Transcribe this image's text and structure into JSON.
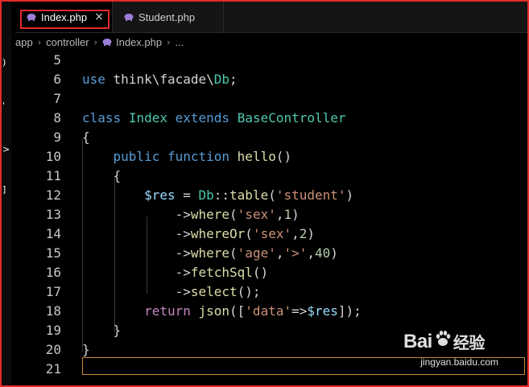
{
  "tabs": [
    {
      "label": "Index.php",
      "active": true,
      "close": "×"
    },
    {
      "label": "Student.php",
      "active": false
    }
  ],
  "breadcrumb": {
    "items": [
      "app",
      "controller",
      "Index.php",
      "..."
    ],
    "separator": "›"
  },
  "code_lines": [
    {
      "n": "5",
      "tokens": []
    },
    {
      "n": "6",
      "tokens": [
        [
          "kw",
          "use"
        ],
        [
          "plain",
          " think\\facade\\"
        ],
        [
          "cls",
          "Db"
        ],
        [
          "plain",
          ";"
        ]
      ]
    },
    {
      "n": "7",
      "tokens": []
    },
    {
      "n": "8",
      "tokens": [
        [
          "kw",
          "class"
        ],
        [
          "plain",
          " "
        ],
        [
          "cls",
          "Index"
        ],
        [
          "plain",
          " "
        ],
        [
          "kw",
          "extends"
        ],
        [
          "plain",
          " "
        ],
        [
          "cls",
          "BaseController"
        ]
      ]
    },
    {
      "n": "9",
      "tokens": [
        [
          "plain",
          "{"
        ]
      ]
    },
    {
      "n": "10",
      "tokens": [
        [
          "plain",
          "    "
        ],
        [
          "kw",
          "public"
        ],
        [
          "plain",
          " "
        ],
        [
          "kw",
          "function"
        ],
        [
          "plain",
          " "
        ],
        [
          "fn",
          "hello"
        ],
        [
          "plain",
          "()"
        ]
      ]
    },
    {
      "n": "11",
      "tokens": [
        [
          "plain",
          "    {"
        ]
      ]
    },
    {
      "n": "12",
      "tokens": [
        [
          "plain",
          "        "
        ],
        [
          "var",
          "$res"
        ],
        [
          "plain",
          " = "
        ],
        [
          "cls",
          "Db"
        ],
        [
          "plain",
          "::"
        ],
        [
          "fn",
          "table"
        ],
        [
          "plain",
          "("
        ],
        [
          "str",
          "'student'"
        ],
        [
          "plain",
          ")"
        ]
      ]
    },
    {
      "n": "13",
      "tokens": [
        [
          "plain",
          "            ->"
        ],
        [
          "fn",
          "where"
        ],
        [
          "plain",
          "("
        ],
        [
          "str",
          "'sex'"
        ],
        [
          "plain",
          ","
        ],
        [
          "num",
          "1"
        ],
        [
          "plain",
          ")"
        ]
      ]
    },
    {
      "n": "14",
      "tokens": [
        [
          "plain",
          "            ->"
        ],
        [
          "fn",
          "whereOr"
        ],
        [
          "plain",
          "("
        ],
        [
          "str",
          "'sex'"
        ],
        [
          "plain",
          ","
        ],
        [
          "num",
          "2"
        ],
        [
          "plain",
          ")"
        ]
      ]
    },
    {
      "n": "15",
      "tokens": [
        [
          "plain",
          "            ->"
        ],
        [
          "fn",
          "where"
        ],
        [
          "plain",
          "("
        ],
        [
          "str",
          "'age'"
        ],
        [
          "plain",
          ","
        ],
        [
          "str",
          "'>'"
        ],
        [
          "plain",
          ","
        ],
        [
          "num",
          "40"
        ],
        [
          "plain",
          ")"
        ]
      ]
    },
    {
      "n": "16",
      "tokens": [
        [
          "plain",
          "            ->"
        ],
        [
          "fn",
          "fetchSql"
        ],
        [
          "plain",
          "()"
        ]
      ]
    },
    {
      "n": "17",
      "tokens": [
        [
          "plain",
          "            ->"
        ],
        [
          "fn",
          "select"
        ],
        [
          "plain",
          "();"
        ]
      ]
    },
    {
      "n": "18",
      "tokens": [
        [
          "plain",
          "        "
        ],
        [
          "ctl",
          "return"
        ],
        [
          "plain",
          " "
        ],
        [
          "fn",
          "json"
        ],
        [
          "plain",
          "(["
        ],
        [
          "str",
          "'data'"
        ],
        [
          "plain",
          "=>"
        ],
        [
          "var",
          "$res"
        ],
        [
          "plain",
          "]);"
        ]
      ]
    },
    {
      "n": "19",
      "tokens": [
        [
          "plain",
          "    }"
        ]
      ]
    },
    {
      "n": "20",
      "tokens": [
        [
          "plain",
          "}"
        ]
      ]
    },
    {
      "n": "21",
      "tokens": []
    }
  ],
  "left_marks": [
    ")",
    "'",
    ">",
    "]"
  ],
  "watermark": {
    "brand_left": "Bai",
    "brand_paw": "paw-icon",
    "brand_right": "经验",
    "url": "jingyan.baidu.com"
  },
  "colors": {
    "highlight_border": "#e52a2a",
    "php_icon": "#9d7fd8",
    "cursor_line_border": "#c8893a"
  }
}
